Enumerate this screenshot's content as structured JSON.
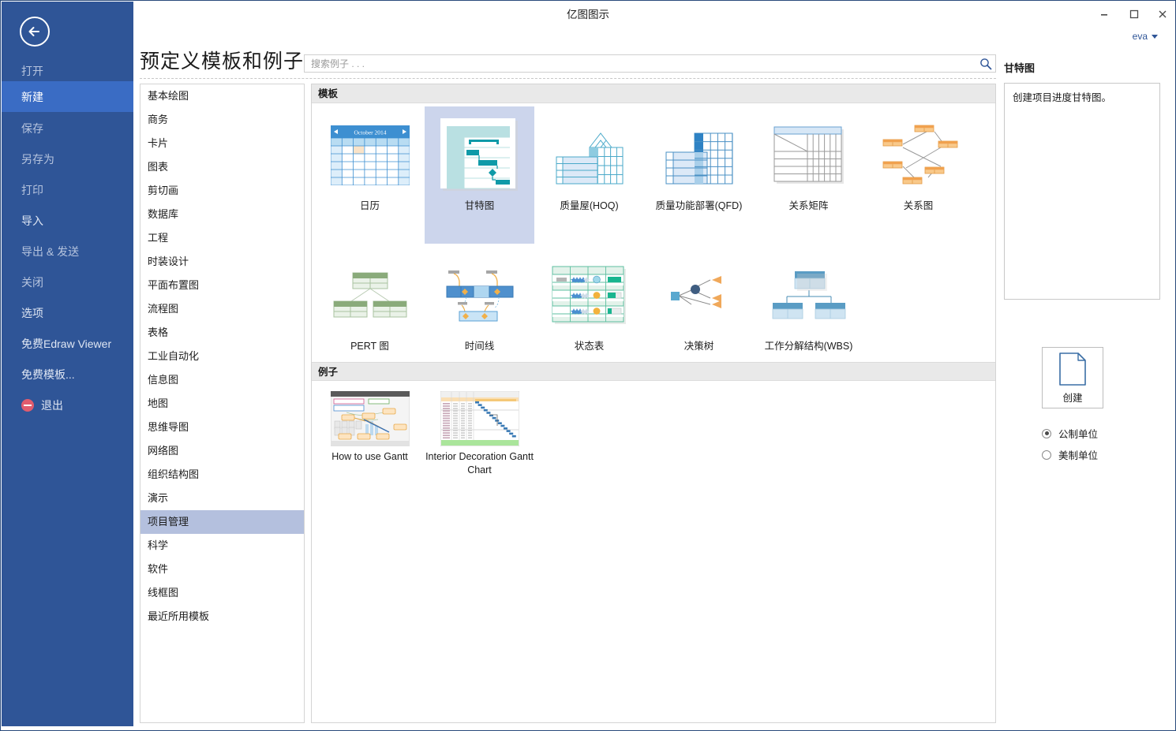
{
  "window": {
    "title": "亿图图示",
    "minimize": "minimize-button",
    "maximize": "maximize-button",
    "close": "close-button"
  },
  "account": {
    "name": "eva"
  },
  "sidebar": {
    "back_icon": "back-arrow-icon",
    "items": [
      {
        "label": "打开",
        "state": "dim"
      },
      {
        "label": "新建",
        "state": "active"
      },
      {
        "label": "保存",
        "state": "dim"
      },
      {
        "label": "另存为",
        "state": "dim"
      },
      {
        "label": "打印",
        "state": "dim"
      },
      {
        "label": "导入",
        "state": "normal"
      },
      {
        "label": "导出 & 发送",
        "state": "dim"
      },
      {
        "label": "关闭",
        "state": "dim"
      },
      {
        "label": "选项",
        "state": "normal"
      },
      {
        "label": "免费Edraw Viewer",
        "state": "normal"
      },
      {
        "label": "免费模板...",
        "state": "normal"
      },
      {
        "label": "退出",
        "state": "normal"
      }
    ]
  },
  "header": {
    "title": "预定义模板和例子",
    "search_placeholder": "搜索例子 . . .",
    "search_value": ""
  },
  "categories": {
    "items": [
      "基本绘图",
      "商务",
      "卡片",
      "图表",
      "剪切画",
      "数据库",
      "工程",
      "时装设计",
      "平面布置图",
      "流程图",
      "表格",
      "工业自动化",
      "信息图",
      "地图",
      "思维导图",
      "网络图",
      "组织结构图",
      "演示",
      "项目管理",
      "科学",
      "软件",
      "线框图",
      "最近所用模板"
    ],
    "selected": "项目管理"
  },
  "templates_section": {
    "heading": "模板",
    "row1": [
      {
        "label": "日历",
        "thumb": "calendar-thumb",
        "selected": false
      },
      {
        "label": "甘特图",
        "thumb": "gantt-thumb",
        "selected": true
      },
      {
        "label": "质量屋(HOQ)",
        "thumb": "hoq-thumb",
        "selected": false
      },
      {
        "label": "质量功能部署(QFD)",
        "thumb": "qfd-thumb",
        "selected": false
      },
      {
        "label": "关系矩阵",
        "thumb": "matrix-thumb",
        "selected": false
      },
      {
        "label": "关系图",
        "thumb": "relation-thumb",
        "selected": false
      }
    ],
    "row2": [
      {
        "label": "PERT 图",
        "thumb": "pert-thumb",
        "selected": false
      },
      {
        "label": "时间线",
        "thumb": "timeline-thumb",
        "selected": false
      },
      {
        "label": "状态表",
        "thumb": "status-table-thumb",
        "selected": false
      },
      {
        "label": "决策树",
        "thumb": "decision-tree-thumb",
        "selected": false
      },
      {
        "label": "工作分解结构(WBS)",
        "thumb": "wbs-thumb",
        "selected": false
      }
    ],
    "calendar_month": "October 2014"
  },
  "examples_section": {
    "heading": "例子",
    "items": [
      {
        "label": "How to use Gantt",
        "thumb": "how-to-use-gantt-thumb"
      },
      {
        "label": "Interior Decoration Gantt Chart",
        "thumb": "interior-decoration-gantt-thumb"
      }
    ]
  },
  "details": {
    "title": "甘特图",
    "description": "创建项目进度甘特图。",
    "create_label": "创建",
    "create_icon": "new-document-icon",
    "units": [
      {
        "label": "公制单位",
        "selected": true
      },
      {
        "label": "美制单位",
        "selected": false
      }
    ]
  },
  "colors": {
    "sidebar": "#2f5597",
    "sidebar_active": "#3a6cc4",
    "category_selected": "#b4c0de",
    "tile_selected": "#ccd5ec",
    "accent": "#2f5597",
    "teal": "#1aa4b0",
    "orange": "#f5b26b"
  }
}
